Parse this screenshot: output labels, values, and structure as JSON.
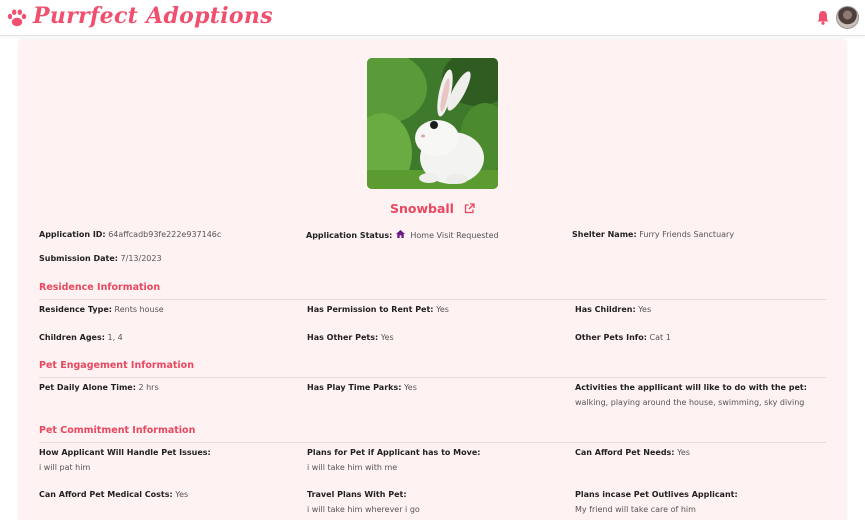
{
  "brand": {
    "name": "Purrfect Adoptions",
    "color": "#f0506e",
    "icon": "paw-icon"
  },
  "header_icons": {
    "notifications": "bell-icon",
    "profile": "user-avatar"
  },
  "pet": {
    "name": "Snowball",
    "photo": "white-rabbit-photo",
    "link_icon": "external-link-icon"
  },
  "application": {
    "id_label": "Application ID:",
    "id_value": "64affcadb93fe222e937146c",
    "status_label": "Application Status:",
    "status_icon": "home-icon",
    "status_value": "Home Visit Requested",
    "shelter_label": "Shelter Name:",
    "shelter_value": "Furry Friends Sanctuary",
    "date_label": "Submission Date:",
    "date_value": "7/13/2023"
  },
  "residence": {
    "title": "Residence Information",
    "type_label": "Residence Type:",
    "type_value": "Rents house",
    "permission_label": "Has Permission to Rent Pet:",
    "permission_value": "Yes",
    "children_label": "Has Children:",
    "children_value": "Yes",
    "ages_label": "Children Ages:",
    "ages_value": "1, 4",
    "other_pets_label": "Has Other Pets:",
    "other_pets_value": "Yes",
    "other_pets_info_label": "Other Pets Info:",
    "other_pets_info_value": "Cat 1"
  },
  "engagement": {
    "title": "Pet Engagement Information",
    "alone_label": "Pet Daily Alone Time:",
    "alone_value": "2 hrs",
    "parks_label": "Has Play Time Parks:",
    "parks_value": "Yes",
    "activities_label": "Activities the appllicant will like to do with the pet:",
    "activities_value": "walking, playing around the house, swimming, sky diving"
  },
  "commitment": {
    "title": "Pet Commitment Information",
    "issues_label": "How Applicant Will Handle Pet Issues:",
    "issues_value": "i will pat him",
    "move_label": "Plans for Pet if Applicant has to Move:",
    "move_value": "i will take him with me",
    "needs_label": "Can Afford Pet Needs:",
    "needs_value": "Yes",
    "medical_label": "Can Afford Pet Medical Costs:",
    "medical_value": "Yes",
    "travel_label": "Travel Plans With Pet:",
    "travel_value": "i will take him wherever i go",
    "outlives_label": "Plans incase Pet Outlives Applicant:",
    "outlives_value": "My friend will take care of him"
  },
  "colors": {
    "accent": "#e8485f",
    "card_background": "#fff2f2"
  }
}
